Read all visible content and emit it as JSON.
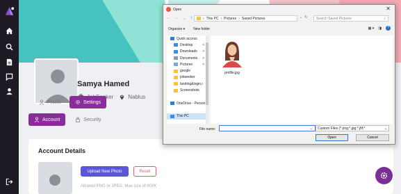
{
  "colors": {
    "sidebar": "#1e1b24",
    "accent_purple": "#8b2c9b",
    "upload_button": "#5a56d8",
    "reset_text": "#e35a6e",
    "banner_teal": "#46c2c1",
    "banner_pink": "#f7c2cc",
    "dialog_bg": "#f2f2f2"
  },
  "sidebar": {
    "items": [
      {
        "icon": "logo-icon"
      },
      {
        "icon": "home-icon"
      },
      {
        "icon": "search-icon"
      },
      {
        "icon": "document-icon"
      },
      {
        "icon": "chat-icon"
      },
      {
        "icon": "user-icon"
      },
      {
        "icon": "logout-icon"
      }
    ]
  },
  "profile": {
    "name": "Samya Hamed",
    "role": "JobSeeker",
    "location": "Nablus"
  },
  "tabs": {
    "profile": "Profile",
    "settings": "Settings"
  },
  "sub_tabs": {
    "account": "Account",
    "security": "Security"
  },
  "account_details": {
    "title": "Account Details",
    "upload_label": "Upload New Photo",
    "reset_label": "Reset",
    "hint": "Allowed PNG or JPEG. Max size of 800K"
  },
  "dialog": {
    "title": "Open",
    "close_glyph": "✕",
    "breadcrumb": [
      "This PC",
      "Pictures",
      "Saved Pictures"
    ],
    "search_placeholder": "Search Saved Pictures",
    "toolbar": {
      "organize": "Organize ▾",
      "new_folder": "New folder"
    },
    "tree": [
      {
        "label": "Quick access",
        "icon": "star-icon",
        "indent": false,
        "selected": false
      },
      {
        "label": "Desktop",
        "icon": "desktop-icon",
        "indent": true,
        "selected": false,
        "pin": "✈"
      },
      {
        "label": "Downloads",
        "icon": "download-icon",
        "indent": true,
        "selected": false,
        "pin": "✈"
      },
      {
        "label": "Documents",
        "icon": "documents-icon",
        "indent": true,
        "selected": false,
        "pin": "✈"
      },
      {
        "label": "Pictures",
        "icon": "pictures-icon",
        "indent": true,
        "selected": false,
        "pin": "✈"
      },
      {
        "label": "google",
        "icon": "folder-icon",
        "indent": true,
        "selected": false
      },
      {
        "label": "jobseeker",
        "icon": "folder-icon",
        "indent": true,
        "selected": false
      },
      {
        "label": "landing&login,r",
        "icon": "folder-icon",
        "indent": true,
        "selected": false
      },
      {
        "label": "Screenshots",
        "icon": "folder-icon",
        "indent": true,
        "selected": false
      },
      {
        "label": "",
        "icon": "",
        "indent": false,
        "selected": false
      },
      {
        "label": "OneDrive - Person",
        "icon": "cloud-icon",
        "indent": false,
        "selected": false
      },
      {
        "label": "",
        "icon": "",
        "indent": false,
        "selected": false
      },
      {
        "label": "This PC",
        "icon": "pc-icon",
        "indent": false,
        "selected": true
      }
    ],
    "file": {
      "name": "profile.jpg"
    },
    "file_name_label": "File name:",
    "file_name_value": "",
    "filter": "Custom Files (*.png;*.jpg;*.jfif;*",
    "open_label": "Open",
    "cancel_label": "Cancel"
  },
  "fab": {
    "icon": "gear-icon"
  }
}
